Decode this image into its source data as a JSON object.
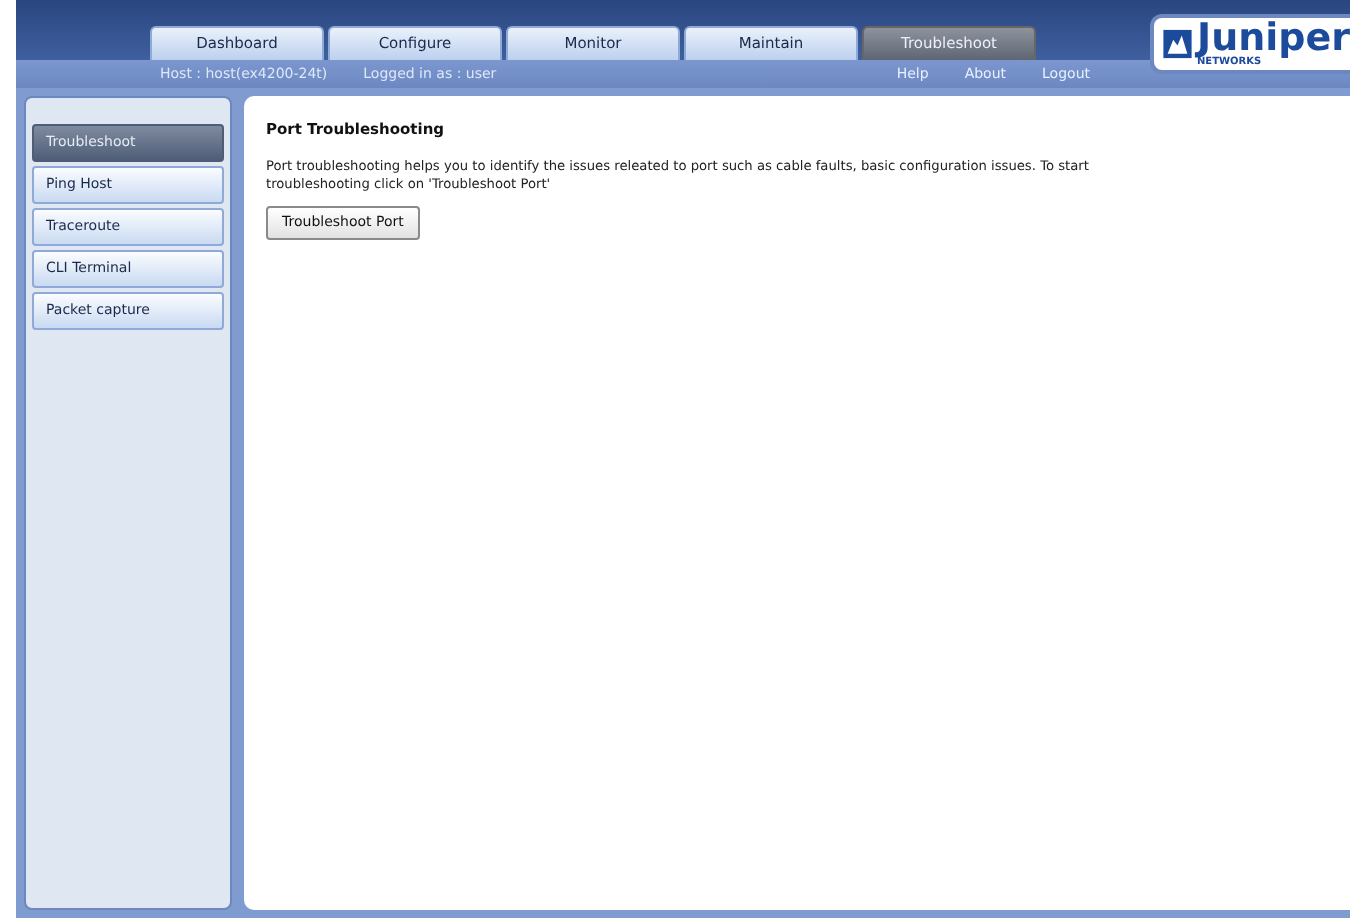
{
  "tabs": [
    {
      "label": "Dashboard",
      "selected": false
    },
    {
      "label": "Configure",
      "selected": false
    },
    {
      "label": "Monitor",
      "selected": false
    },
    {
      "label": "Maintain",
      "selected": false
    },
    {
      "label": "Troubleshoot",
      "selected": true
    }
  ],
  "host": "Host : host(ex4200-24t)",
  "user": "Logged in as : user",
  "links": [
    "Help",
    "About",
    "Logout"
  ],
  "logo": {
    "name": "Juniper",
    "sub": "NETWORKS"
  },
  "sidebar": {
    "items": [
      {
        "label": "Troubleshoot",
        "selected": true
      },
      {
        "label": "Ping Host",
        "selected": false
      },
      {
        "label": "Traceroute",
        "selected": false
      },
      {
        "label": "CLI Terminal",
        "selected": false
      },
      {
        "label": "Packet capture",
        "selected": false
      }
    ]
  },
  "content": {
    "title": "Port Troubleshooting",
    "text": "Port troubleshooting helps you to identify the issues releated to port such as cable faults, basic configuration issues. To start troubleshooting click on 'Troubleshoot Port'",
    "button": "Troubleshoot Port"
  }
}
